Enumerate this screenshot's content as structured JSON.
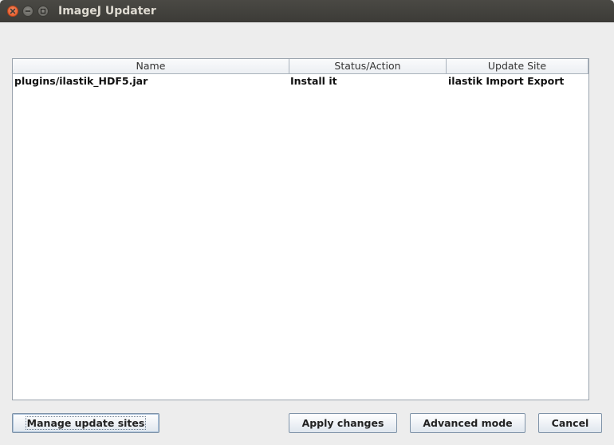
{
  "window": {
    "title": "ImageJ Updater"
  },
  "table": {
    "columns": {
      "name": "Name",
      "status": "Status/Action",
      "site": "Update Site"
    },
    "rows": [
      {
        "name": "plugins/ilastik_HDF5.jar",
        "status": "Install it",
        "site": "ilastik Import Export"
      }
    ]
  },
  "buttons": {
    "manage": "Manage update sites",
    "apply": "Apply changes",
    "advanced": "Advanced mode",
    "cancel": "Cancel"
  },
  "icons": {
    "close": "close-icon",
    "minimize": "minimize-icon",
    "maximize": "maximize-icon"
  },
  "colors": {
    "titlebar": "#3c3b37",
    "close_button": "#e45320",
    "button_border": "#7f93a8"
  }
}
